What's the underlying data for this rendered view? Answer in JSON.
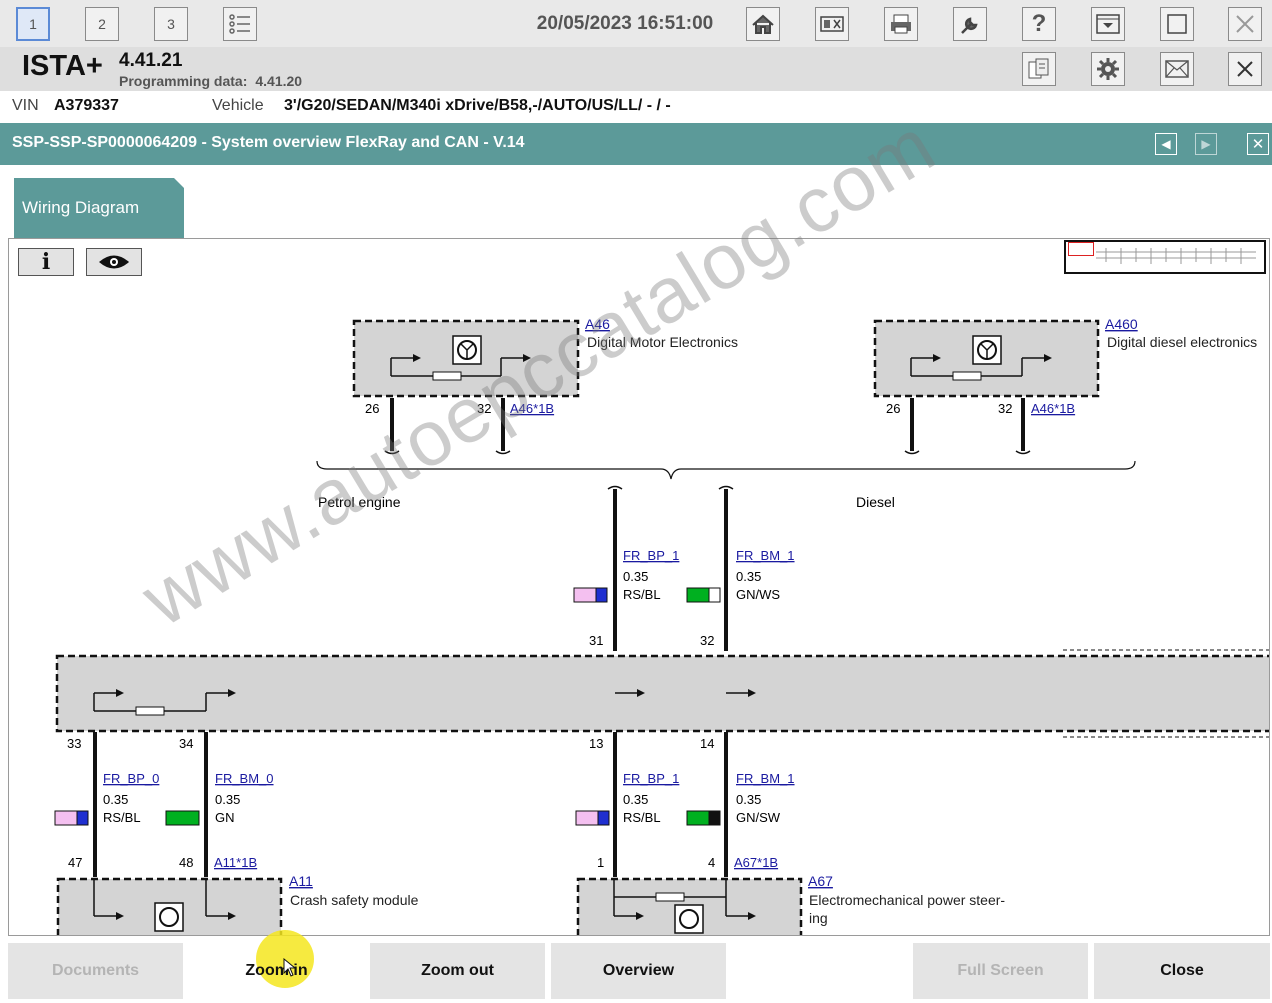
{
  "toolbar": {
    "tabs": [
      "1",
      "2",
      "3"
    ],
    "datetime": "20/05/2023 16:51:00"
  },
  "app": {
    "name": "ISTA+",
    "version": "4.41.21",
    "programming_label": "Programming data:",
    "programming_version": "4.41.20"
  },
  "vehicle": {
    "vin_label": "VIN",
    "vin": "A379337",
    "vehicle_label": "Vehicle",
    "vehicle": "3'/G20/SEDAN/M340i xDrive/B58,-/AUTO/US/LL/ - / -"
  },
  "document": {
    "title": "SSP-SSP-SP0000064209 - System overview FlexRay and CAN - V.14"
  },
  "tab": {
    "label": "Wiring Diagram"
  },
  "diagram": {
    "a46": {
      "id": "A46",
      "name": "Digital Motor Electronics",
      "conn": "A46*1B",
      "pin_left": "26",
      "pin_right": "32"
    },
    "a460": {
      "id": "A460",
      "name": "Digital diesel electronics",
      "conn": "A46*1B",
      "pin_left": "26",
      "pin_right": "32"
    },
    "group_petrol": "Petrol engine",
    "group_diesel": "Diesel",
    "wire_top_1": {
      "name": "FR_BP_1",
      "size": "0.35",
      "color": "RS/BL"
    },
    "wire_top_2": {
      "name": "FR_BM_1",
      "size": "0.35",
      "color": "GN/WS"
    },
    "pin_31": "31",
    "pin_32b": "32",
    "pin_33": "33",
    "pin_34": "34",
    "pin_13": "13",
    "pin_14": "14",
    "wire_l1": {
      "name": "FR_BP_0",
      "size": "0.35",
      "color": "RS/BL"
    },
    "wire_l2": {
      "name": "FR_BM_0",
      "size": "0.35",
      "color": "GN"
    },
    "wire_r1": {
      "name": "FR_BP_1",
      "size": "0.35",
      "color": "RS/BL"
    },
    "wire_r2": {
      "name": "FR_BM_1",
      "size": "0.35",
      "color": "GN/SW"
    },
    "pin_47": "47",
    "pin_48": "48",
    "pin_1": "1",
    "pin_4": "4",
    "a11": {
      "id": "A11",
      "name": "Crash safety module",
      "conn": "A11*1B"
    },
    "a67": {
      "id": "A67",
      "name_line1": "Electromechanical power steer-",
      "name_line2": "ing",
      "conn": "A67*1B"
    }
  },
  "watermark": "www.autoepccatalog.com",
  "buttons": {
    "documents": "Documents",
    "zoom_in": "Zoom in",
    "zoom_out": "Zoom out",
    "overview": "Overview",
    "full_screen": "Full Screen",
    "close": "Close"
  },
  "colors": {
    "teal": "#5c9a99",
    "pink": "#f4c0f0",
    "blue": "#1f2fd0",
    "green": "#00b020"
  }
}
